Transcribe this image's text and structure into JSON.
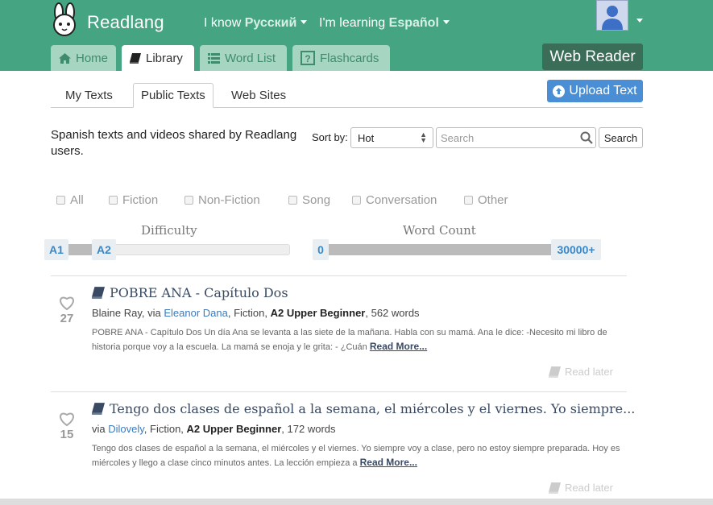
{
  "app": {
    "name": "Readlang",
    "brand_color": "#45a583"
  },
  "header": {
    "know_prefix": "I know",
    "know_lang": "Русский",
    "learn_prefix": "I'm learning",
    "learn_lang": "Español"
  },
  "tabs": [
    {
      "label": "Home",
      "icon": "home-icon"
    },
    {
      "label": "Library",
      "icon": "book-icon",
      "active": true
    },
    {
      "label": "Word List",
      "icon": "list-icon"
    },
    {
      "label": "Flashcards",
      "icon": "question-icon"
    }
  ],
  "web_reader_label": "Web Reader",
  "subtabs": [
    "My Texts",
    "Public Texts",
    "Web Sites"
  ],
  "upload_label": "Upload Text",
  "description": "Spanish texts and videos shared by Readlang users.",
  "sort": {
    "label": "Sort by:",
    "value": "Hot"
  },
  "search": {
    "placeholder": "Search",
    "button": "Search"
  },
  "filters": [
    "All",
    "Fiction",
    "Non-Fiction",
    "Song",
    "Conversation",
    "Other"
  ],
  "difficulty": {
    "label": "Difficulty",
    "min": "A1",
    "max": "A2"
  },
  "word_count": {
    "label": "Word Count",
    "min": "0",
    "max": "30000+"
  },
  "texts": [
    {
      "likes": "27",
      "title": "POBRE ANA - Capítulo Dos",
      "meta_prefix": "Blaine Ray, via ",
      "user": "Eleanor Dana",
      "genre": ", Fiction, ",
      "level": "A2 Upper Beginner",
      "words": ", 562 words",
      "excerpt": "POBRE ANA - Capítulo Dos Un día Ana se levanta a las siete de la mañana. Habla con su mamá. Ana le dice: -Necesito mi libro de historia porque voy a la escuela. La mamá se enoja y le grita: - ¿Cuán ",
      "read_more": "Read More...",
      "read_later": "Read later"
    },
    {
      "likes": "15",
      "title": "Tengo dos clases de español a la semana, el miércoles y el viernes. Yo siempre...",
      "meta_prefix": "via ",
      "user": "Dilovely",
      "genre": ", Fiction, ",
      "level": "A2 Upper Beginner",
      "words": ", 172 words",
      "excerpt": "Tengo dos clases de español a la semana, el miércoles y el viernes. Yo siempre voy a clase, pero no estoy siempre preparada. Hoy es miércoles y llego a clase cinco minutos antes. La lección empieza a ",
      "read_more": "Read More...",
      "read_later": "Read later"
    }
  ]
}
